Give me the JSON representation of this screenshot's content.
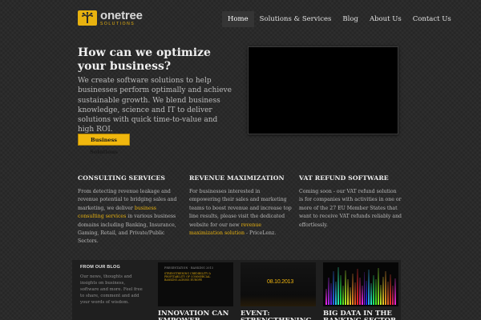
{
  "brand": {
    "name": "onetree",
    "tagline": "SOLUTIONS",
    "accent": "#f0b70e"
  },
  "nav": {
    "items": [
      {
        "label": "Home",
        "active": true
      },
      {
        "label": "Solutions & Services",
        "active": false
      },
      {
        "label": "Blog",
        "active": false
      },
      {
        "label": "About Us",
        "active": false
      },
      {
        "label": "Contact Us",
        "active": false
      }
    ]
  },
  "hero": {
    "title": "How can we optimize your business?",
    "text": "We create software solutions to help businesses perform optimally and achieve sustainable growth. We blend business knowledge, science and IT to deliver solutions with quick time-to-value and high ROI.",
    "button_label": "Business Solutions"
  },
  "services": [
    {
      "title": "CONSULTING SERVICES",
      "text_before": "From detecting revenue leakage and revenue potential to bridging sales and marketing, we deliver ",
      "link": "business consulting services",
      "text_after": " in various business domains including Banking, Insurance, Gaming, Retail, and Private/Public Sectors."
    },
    {
      "title": "REVENUE MAXIMIZATION",
      "text_before": "For businesses interested in empowering their sales and marketing teams to boost revenue and increase top line results, please visit the dedicated website for our new ",
      "link": "revenue maximization solution",
      "text_after": " - PriceLenz."
    },
    {
      "title": "VAT REFUND SOFTWARE",
      "text_before": "Coming soon - our VAT refund solution is for companies with activities in one or more of the 27 EU Member States that want to receive VAT refunds reliably and effortlessly.",
      "link": "",
      "text_after": ""
    }
  ],
  "blog": {
    "heading": "FROM OUR BLOG",
    "intro": "Our news, thoughts and insights on business, software and more. Feel free to share, comment and add your words of wisdom.",
    "posts": [
      {
        "title": "INNOVATION CAN EMPOWER BANKING",
        "thumb_small": "PRESENTATION · BANKING 2013",
        "thumb_text": "STRENGTHENING CREDIBILITY & PROFITABILITY OF COMMERCIAL BANKING ACROSS EUROPE"
      },
      {
        "title": "EVENT: STRENGTHENING",
        "thumb_date": "08.10.2013"
      },
      {
        "title": "BIG DATA IN THE BANKING SECTOR"
      }
    ]
  }
}
